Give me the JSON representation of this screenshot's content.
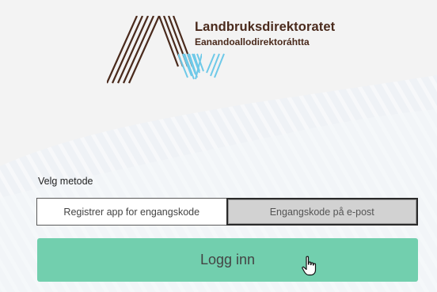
{
  "brand": {
    "name": "Landbruksdirektoratet",
    "subtitle": "Eanandoallodirektoráhtta"
  },
  "method": {
    "label": "Velg metode",
    "options": [
      "Registrer app for engangskode",
      "Engangskode på e-post"
    ],
    "selected_index": 1
  },
  "login": {
    "label": "Logg inn"
  },
  "colors": {
    "accent": "#72cfae",
    "brand_text": "#4a2a1c",
    "logo_blue": "#6ec9e8"
  }
}
